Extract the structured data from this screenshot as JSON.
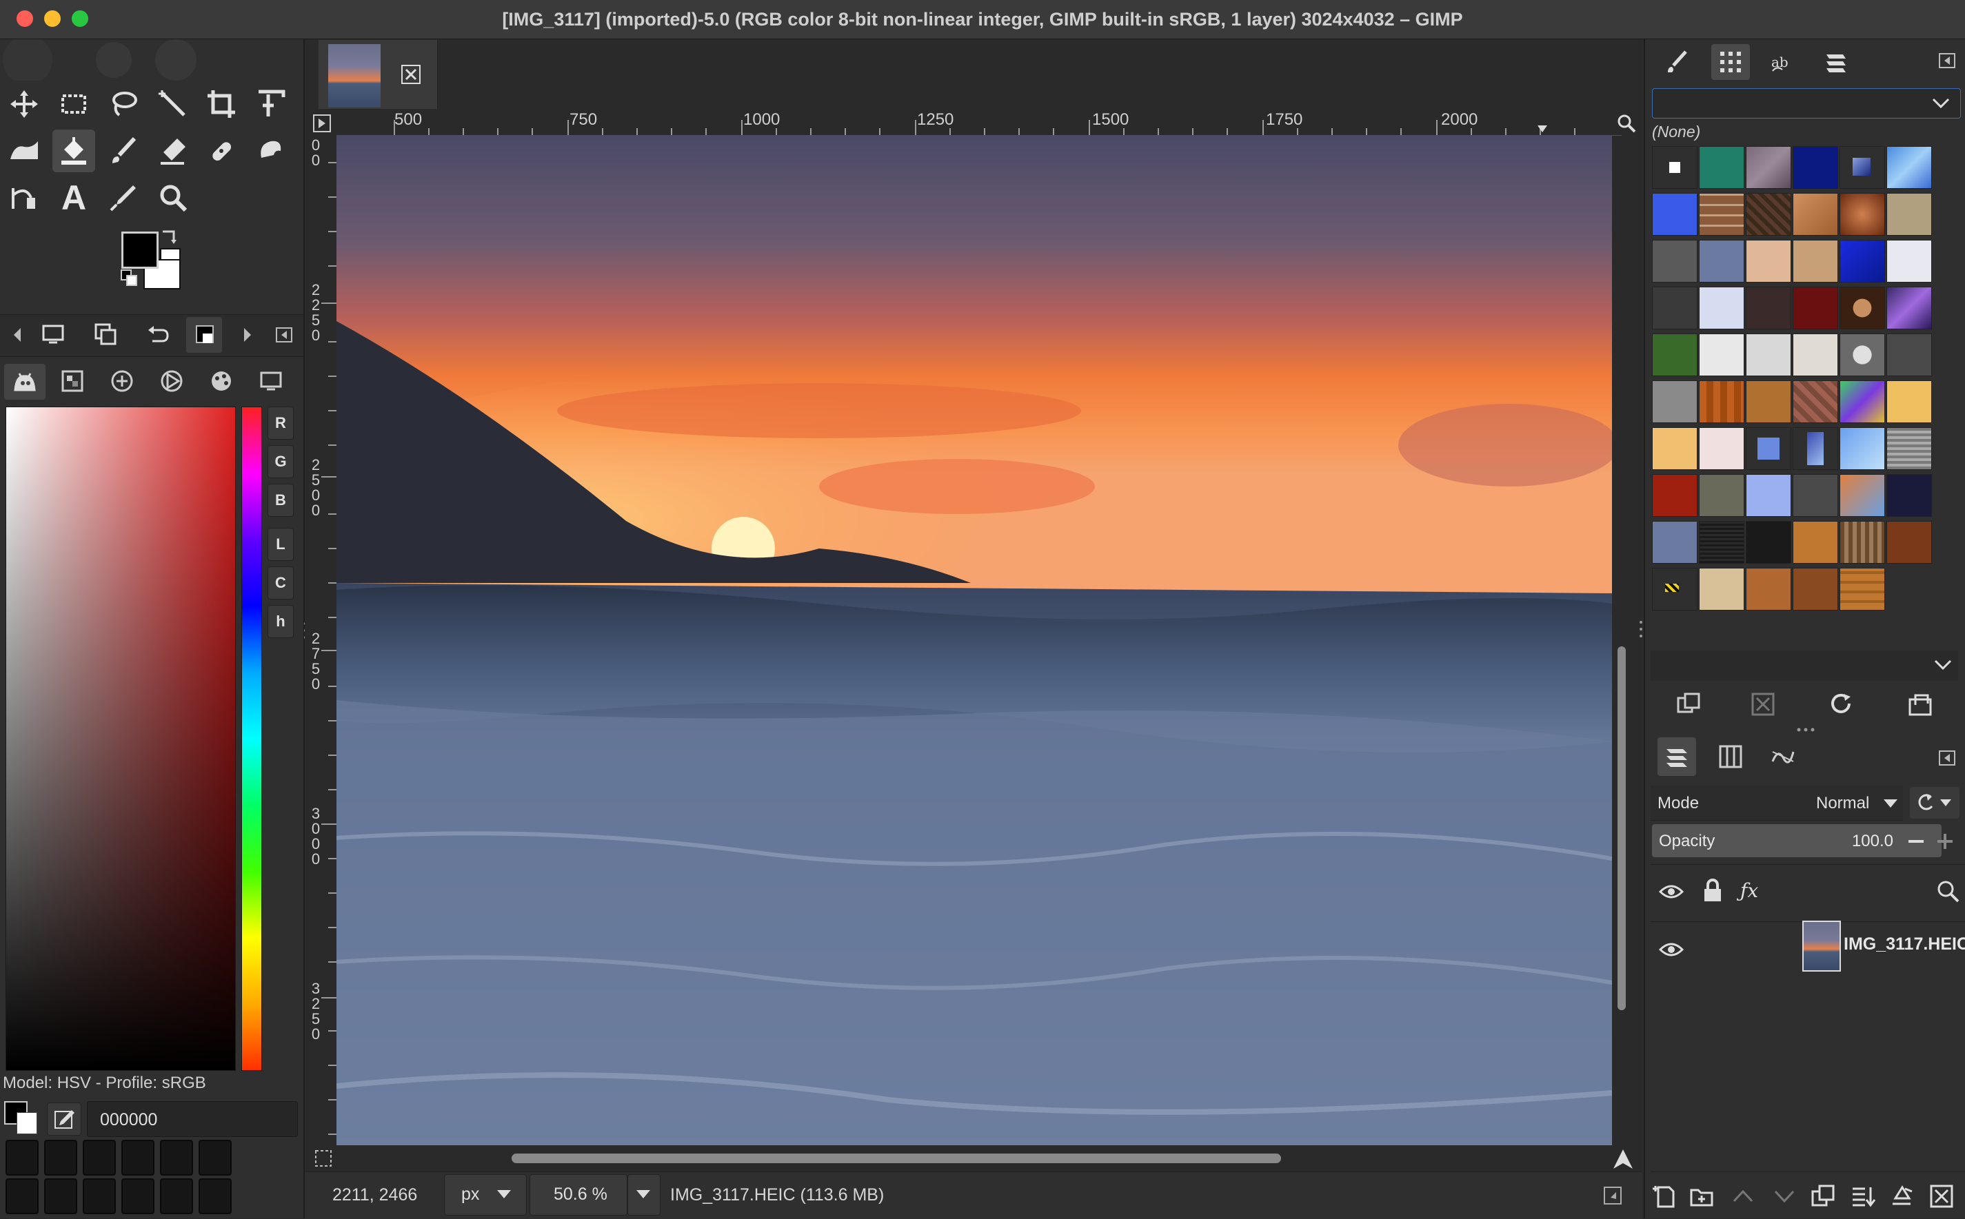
{
  "window": {
    "title": "[IMG_3117] (imported)-5.0 (RGB color 8-bit non-linear integer, GIMP built-in sRGB, 1 layer) 3024x4032 – GIMP"
  },
  "colors": {
    "close": "#ff5f57",
    "minimize": "#febc2e",
    "maximize": "#28c840",
    "accent_selection": "#4a4a4a"
  },
  "toolbox": {
    "tools": [
      {
        "name": "move-tool-icon"
      },
      {
        "name": "rect-select-icon"
      },
      {
        "name": "lasso-icon"
      },
      {
        "name": "fuzzy-select-icon"
      },
      {
        "name": "crop-icon"
      },
      {
        "name": "unified-transform-icon"
      },
      {
        "name": "warp-icon"
      },
      {
        "name": "bucket-fill-icon"
      },
      {
        "name": "paintbrush-icon"
      },
      {
        "name": "eraser-icon"
      },
      {
        "name": "heal-icon"
      },
      {
        "name": "smudge-icon"
      },
      {
        "name": "paths-icon"
      },
      {
        "name": "text-tool-icon"
      },
      {
        "name": "color-picker-icon"
      },
      {
        "name": "zoom-icon"
      }
    ],
    "text_tool_glyph": "A"
  },
  "color_panel": {
    "channels": [
      "R",
      "G",
      "B",
      "L",
      "C",
      "h"
    ],
    "model_label": "Model: HSV - Profile: sRGB",
    "hex_value": "000000"
  },
  "ruler": {
    "h_labels": [
      "500",
      "750",
      "1000",
      "1250",
      "1500",
      "1750",
      "2000"
    ],
    "v_labels": [
      "0\n0",
      "2\n2\n5\n0",
      "2\n5\n0\n0",
      "2\n7\n5\n0",
      "3\n0\n0\n0",
      "3\n2\n5\n0"
    ]
  },
  "statusbar": {
    "coords": "2211, 2466",
    "unit": "px",
    "zoom": "50.6 %",
    "file_info": "IMG_3117.HEIC (113.6 MB)"
  },
  "patterns": {
    "selected_name": "(None)"
  },
  "layers": {
    "mode_label": "Mode",
    "mode_value": "Normal",
    "opacity_label": "Opacity",
    "opacity_value": "100.0",
    "items": [
      {
        "name": "IMG_3117.HEIC"
      }
    ]
  }
}
